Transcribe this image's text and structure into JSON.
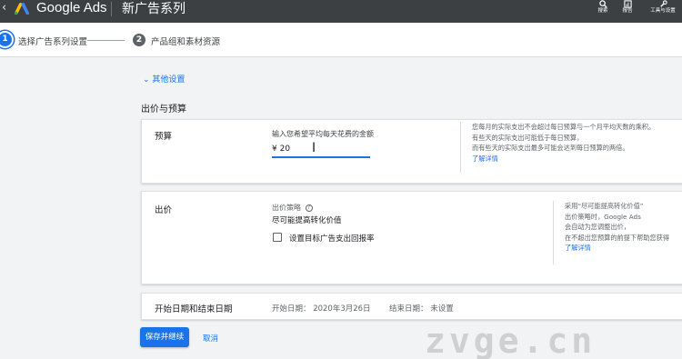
{
  "header": {
    "back_icon": "chevron-left",
    "brand": "Google Ads",
    "campaign_title": "新广告系列",
    "tools": [
      {
        "icon": "search-icon",
        "label": "搜索"
      },
      {
        "icon": "reports-icon",
        "label": "报告"
      },
      {
        "icon": "tools-settings-icon",
        "label": "工具与设置"
      }
    ]
  },
  "steps": {
    "step1": {
      "number": "1",
      "label": "选择广告系列设置"
    },
    "step2": {
      "number": "2",
      "label": "产品组和素材资源"
    }
  },
  "main": {
    "more_settings": "其他设置",
    "section_title": "出价与预算",
    "budget": {
      "title": "预算",
      "hint": "输入您希望平均每天花费的金额",
      "currency": "¥",
      "value": "20",
      "note": [
        "您每月的实际支出不会超过每日预算与一个月平均天数的乘积。",
        "有些天的实际支出可能低于每日预算，",
        "而有些天的实际支出最多可能会达到每日预算的两倍。"
      ],
      "learn_more": "了解详情"
    },
    "bidding": {
      "title": "出价",
      "strategy_label": "出价策略",
      "strategy_value": "尽可能提高转化价值",
      "checkbox_label": "设置目标广告支出回报率",
      "checkbox_checked": false,
      "note": [
        "采用“尽可能提高转化价值”",
        "出价策略时，Google Ads",
        "会自动为您调整出价，",
        "在不超出您预算的前提下帮助您获得"
      ],
      "learn_more": "了解详情"
    },
    "dates": {
      "title": "开始日期和结束日期",
      "start": "开始日期：  2020年3月26日",
      "end": "结束日期：  未设置"
    }
  },
  "footer": {
    "save_label": "保存并继续",
    "cancel_label": "取消"
  },
  "watermark": "zvge.cn",
  "colors": {
    "accent": "#1a73e8",
    "topbar": "#3c4043",
    "background": "#f1f3f4"
  }
}
